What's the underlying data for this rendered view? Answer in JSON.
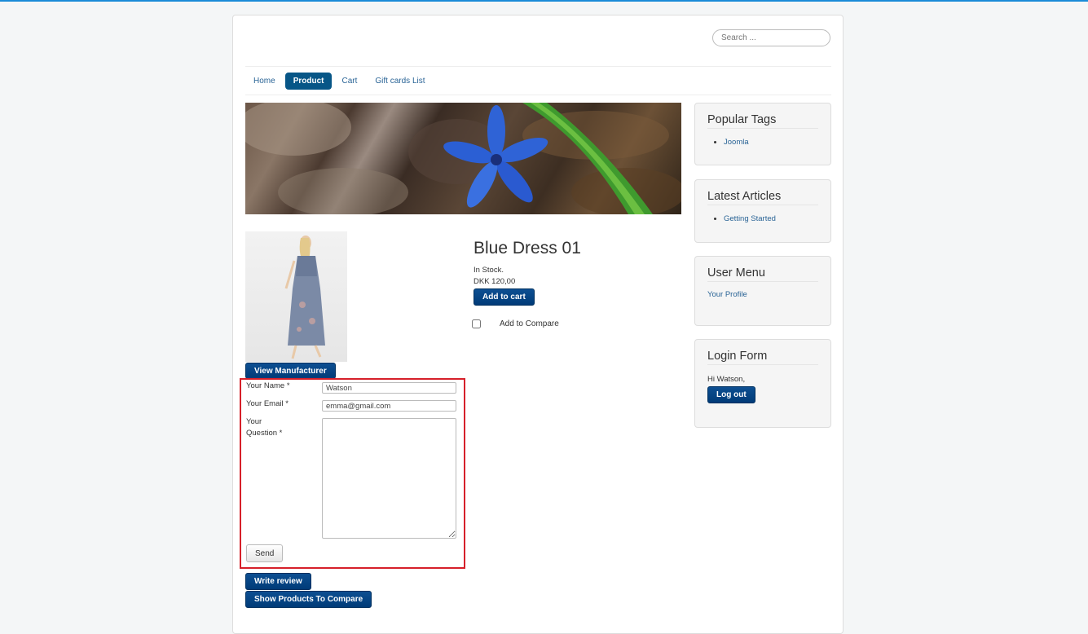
{
  "search": {
    "placeholder": "Search ..."
  },
  "nav": {
    "items": [
      {
        "label": "Home"
      },
      {
        "label": "Product"
      },
      {
        "label": "Cart"
      },
      {
        "label": "Gift cards List"
      }
    ],
    "active": "Product"
  },
  "product": {
    "title": "Blue Dress 01",
    "stock": "In Stock.",
    "price": "DKK 120,00",
    "add_to_cart": "Add to cart",
    "add_to_compare": "Add to Compare",
    "view_manufacturer": "View Manufacturer"
  },
  "question_form": {
    "name_label": "Your Name *",
    "name_value": "Watson",
    "email_label": "Your Email *",
    "email_value": "emma@gmail.com",
    "question_label_1": "Your",
    "question_label_2": "Question *",
    "send": "Send"
  },
  "actions": {
    "write_review": "Write review",
    "show_compare": "Show Products To Compare"
  },
  "sidebar": {
    "popular_tags": {
      "title": "Popular Tags",
      "items": [
        "Joomla"
      ]
    },
    "latest_articles": {
      "title": "Latest Articles",
      "items": [
        "Getting Started"
      ]
    },
    "user_menu": {
      "title": "User Menu",
      "link": "Your Profile"
    },
    "login_form": {
      "title": "Login Form",
      "greeting": "Hi Watson,",
      "logout": "Log out"
    }
  },
  "colors": {
    "accent": "#075687",
    "button": "#003b78",
    "highlight_border": "#d6202a",
    "top_bar": "#1a8bd8"
  }
}
